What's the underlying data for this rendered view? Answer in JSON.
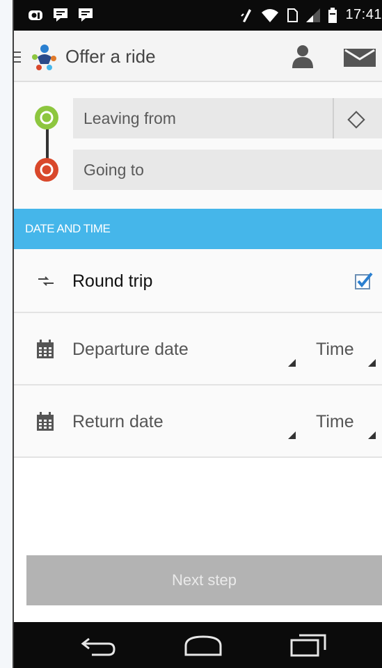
{
  "status_bar": {
    "time": "17:41",
    "left_icons": [
      "app-notification-icon",
      "chat-icon",
      "chat-icon"
    ],
    "right_icons": [
      "vibrate-icon",
      "wifi-icon",
      "sim-icon",
      "signal-icon",
      "battery-icon"
    ]
  },
  "app_bar": {
    "title": "Offer a ride",
    "icons": [
      "menu-icon",
      "app-logo-icon",
      "user-icon",
      "mail-icon"
    ]
  },
  "route": {
    "from_placeholder": "Leaving from",
    "to_placeholder": "Going to",
    "locate_icon": "locate-icon"
  },
  "section": {
    "header": "DATE AND TIME"
  },
  "trip": {
    "label": "Round trip",
    "checked": true
  },
  "departure": {
    "date_label": "Departure date",
    "time_label": "Time"
  },
  "return": {
    "date_label": "Return date",
    "time_label": "Time"
  },
  "next_button": {
    "label": "Next step"
  },
  "colors": {
    "accent": "#45b6ea",
    "from_dot": "#8dc63f",
    "to_dot": "#d9482b",
    "button_disabled": "#b3b3b3"
  }
}
